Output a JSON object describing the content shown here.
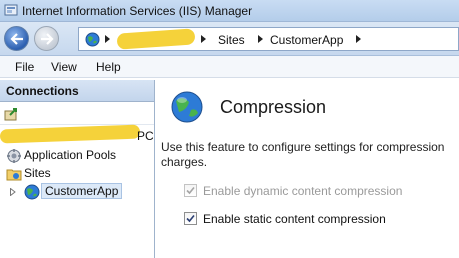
{
  "window": {
    "title": "Internet Information Services (IIS) Manager"
  },
  "address_bar": {
    "crumbs": [
      "Sites",
      "CustomerApp"
    ]
  },
  "menu": {
    "items": [
      "File",
      "View",
      "Help"
    ]
  },
  "connections": {
    "title": "Connections",
    "server_suffix": "PC",
    "tree": [
      {
        "label": "Application Pools",
        "icon": "application-pools-icon"
      },
      {
        "label": "Sites",
        "icon": "sites-folder-icon"
      },
      {
        "label": "CustomerApp",
        "icon": "globe-icon",
        "selected": true
      }
    ]
  },
  "feature": {
    "title": "Compression",
    "description": "Use this feature to configure settings for compression charges.",
    "options": [
      {
        "label": "Enable dynamic content compression",
        "checked": true,
        "enabled": false
      },
      {
        "label": "Enable static content compression",
        "checked": true,
        "enabled": true
      }
    ]
  },
  "colors": {
    "redaction": "#f5d23a",
    "selection": "#dce9f8",
    "title_bar": "#c9dcf3"
  }
}
